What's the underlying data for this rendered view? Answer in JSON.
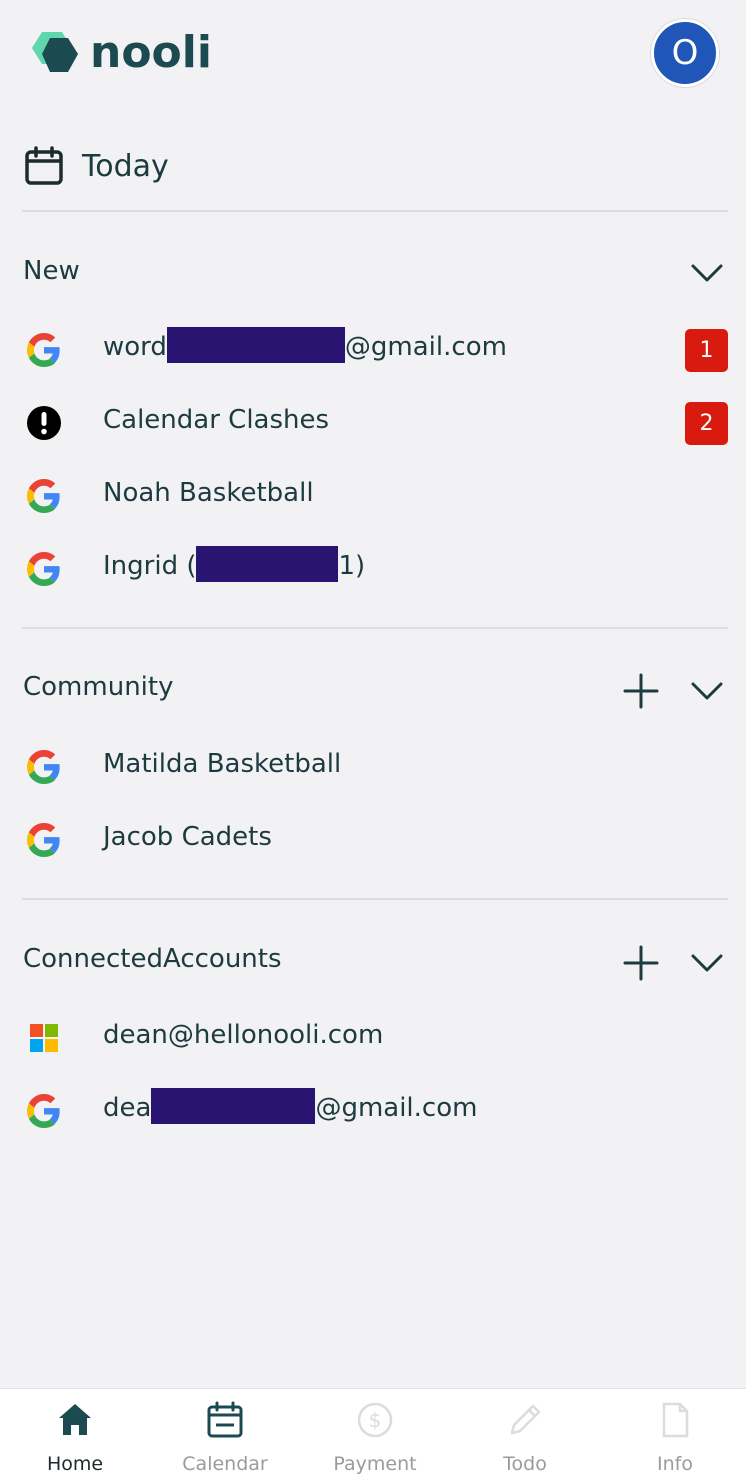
{
  "app": {
    "brand": "nooli",
    "avatar_letter": "O"
  },
  "today": {
    "label": "Today"
  },
  "sections": {
    "new": {
      "title": "New",
      "items": [
        {
          "prefix": "word",
          "suffix": "@gmail.com",
          "icon": "google-icon",
          "badge": "1"
        },
        {
          "label": "Calendar Clashes",
          "icon": "alert-icon",
          "badge": "2"
        },
        {
          "label": "Noah Basketball",
          "icon": "google-icon"
        },
        {
          "prefix": "Ingrid (",
          "suffix": "1)",
          "icon": "google-icon"
        }
      ]
    },
    "community": {
      "title": "Community",
      "items": [
        {
          "label": "Matilda Basketball",
          "icon": "google-icon"
        },
        {
          "label": "Jacob Cadets",
          "icon": "google-icon"
        }
      ]
    },
    "connected": {
      "title": "ConnectedAccounts",
      "items": [
        {
          "label": "dean@hellonooli.com",
          "icon": "microsoft-icon"
        },
        {
          "prefix": "dea",
          "suffix": "@gmail.com",
          "icon": "google-icon"
        }
      ]
    }
  },
  "nav": {
    "home": "Home",
    "calendar": "Calendar",
    "payment": "Payment",
    "todo": "Todo",
    "info": "Info"
  },
  "colors": {
    "background": "#f2f2f5",
    "text": "#1d3b3f",
    "badge": "#d81b0e",
    "avatar": "#1f56b8",
    "redaction": "#2a1472"
  }
}
